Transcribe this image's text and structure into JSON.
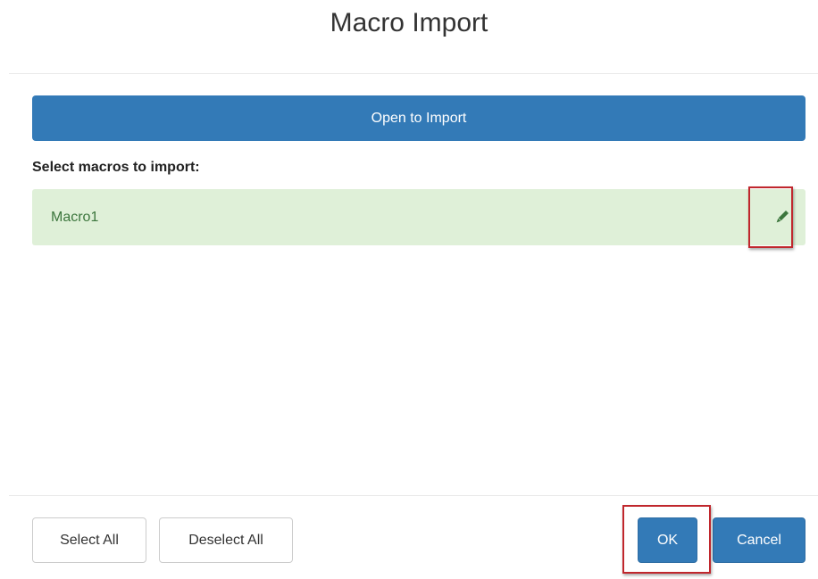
{
  "dialog": {
    "title": "Macro Import"
  },
  "toolbar": {
    "open_import_label": "Open to Import"
  },
  "selection": {
    "label": "Select macros to import:",
    "macros": [
      {
        "name": "Macro1",
        "selected": true,
        "edit_icon": "pencil-icon"
      }
    ]
  },
  "footer": {
    "select_all_label": "Select All",
    "deselect_all_label": "Deselect All",
    "ok_label": "OK",
    "cancel_label": "Cancel"
  },
  "colors": {
    "primary": "#337ab7",
    "selected_row_bg": "#dff0d8",
    "selected_row_text": "#3c763d",
    "highlight": "#c0272d"
  }
}
